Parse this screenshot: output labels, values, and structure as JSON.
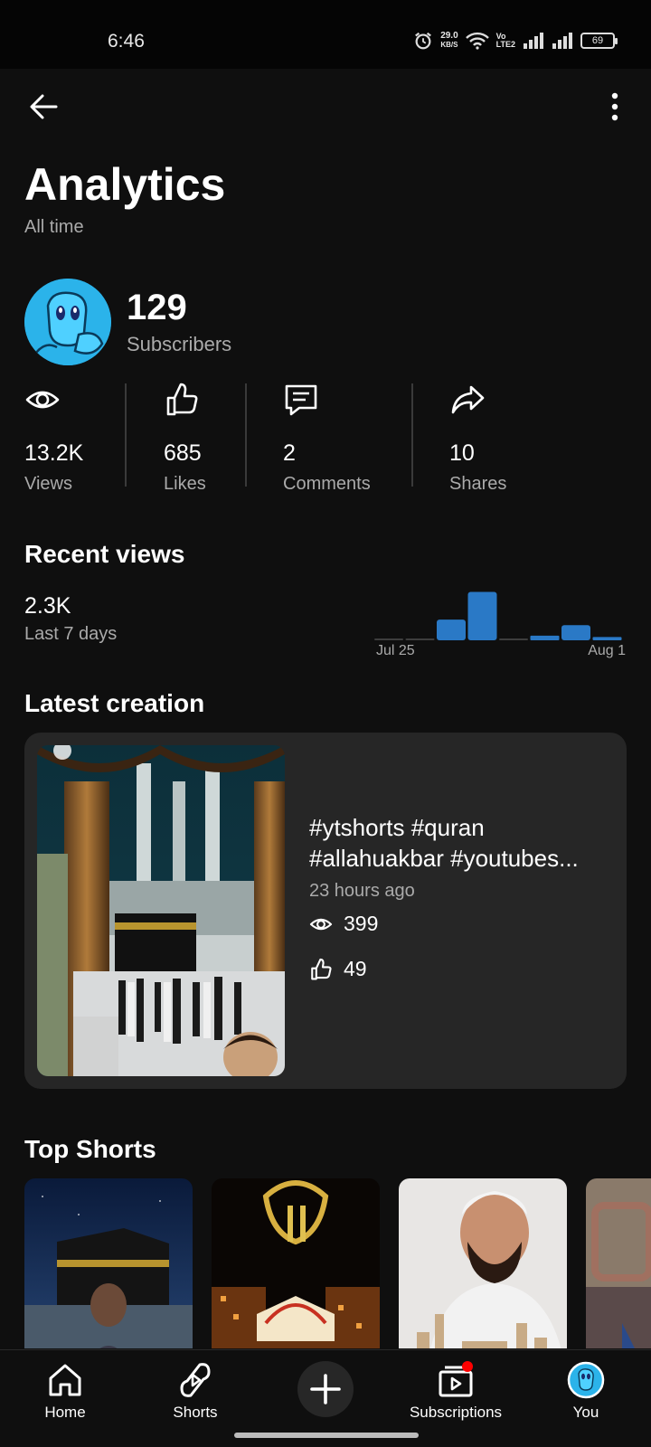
{
  "status_bar": {
    "time": "6:46",
    "net_speed": "29.0",
    "net_unit": "KB/S",
    "volte": "Vo",
    "lte": "LTE2",
    "battery": "69"
  },
  "header": {
    "title": "Analytics",
    "subtitle": "All time"
  },
  "channel": {
    "subscribers": "129",
    "subscribers_label": "Subscribers"
  },
  "stats": [
    {
      "icon": "eye-icon",
      "value": "13.2K",
      "label": "Views"
    },
    {
      "icon": "thumbs-up-icon",
      "value": "685",
      "label": "Likes"
    },
    {
      "icon": "comment-icon",
      "value": "2",
      "label": "Comments"
    },
    {
      "icon": "share-icon",
      "value": "10",
      "label": "Shares"
    }
  ],
  "recent_views": {
    "heading": "Recent views",
    "value": "2.3K",
    "period": "Last 7 days",
    "axis_start": "Jul 25",
    "axis_end": "Aug 1"
  },
  "chart_data": {
    "type": "bar",
    "categories": [
      "Jul 25",
      "Jul 26",
      "Jul 27",
      "Jul 28",
      "Jul 29",
      "Jul 30",
      "Jul 31",
      "Aug 1"
    ],
    "values": [
      20,
      20,
      450,
      1050,
      20,
      100,
      330,
      70
    ],
    "title": "",
    "xlabel": "",
    "ylabel": "",
    "ylim": [
      0,
      1100
    ],
    "colors": {
      "bar": "#2a79c6",
      "zero": "#3d3d3d"
    }
  },
  "latest_creation": {
    "heading": "Latest creation",
    "title_line1": "#ytshorts #quran",
    "title_line2": "#allahuakbar #youtubes...",
    "time": "23 hours ago",
    "views": "399",
    "likes": "49"
  },
  "top_shorts": {
    "heading": "Top Shorts"
  },
  "bottom_nav": [
    {
      "icon": "home-icon",
      "label": "Home"
    },
    {
      "icon": "shorts-icon",
      "label": "Shorts"
    },
    {
      "icon": "create-icon",
      "label": ""
    },
    {
      "icon": "subscriptions-icon",
      "label": "Subscriptions"
    },
    {
      "icon": "you-avatar-icon",
      "label": "You"
    }
  ],
  "colors": {
    "background": "#0f0f0f",
    "card": "#262626",
    "accent_bar": "#2a79c6",
    "notification_dot": "#ff0000"
  }
}
